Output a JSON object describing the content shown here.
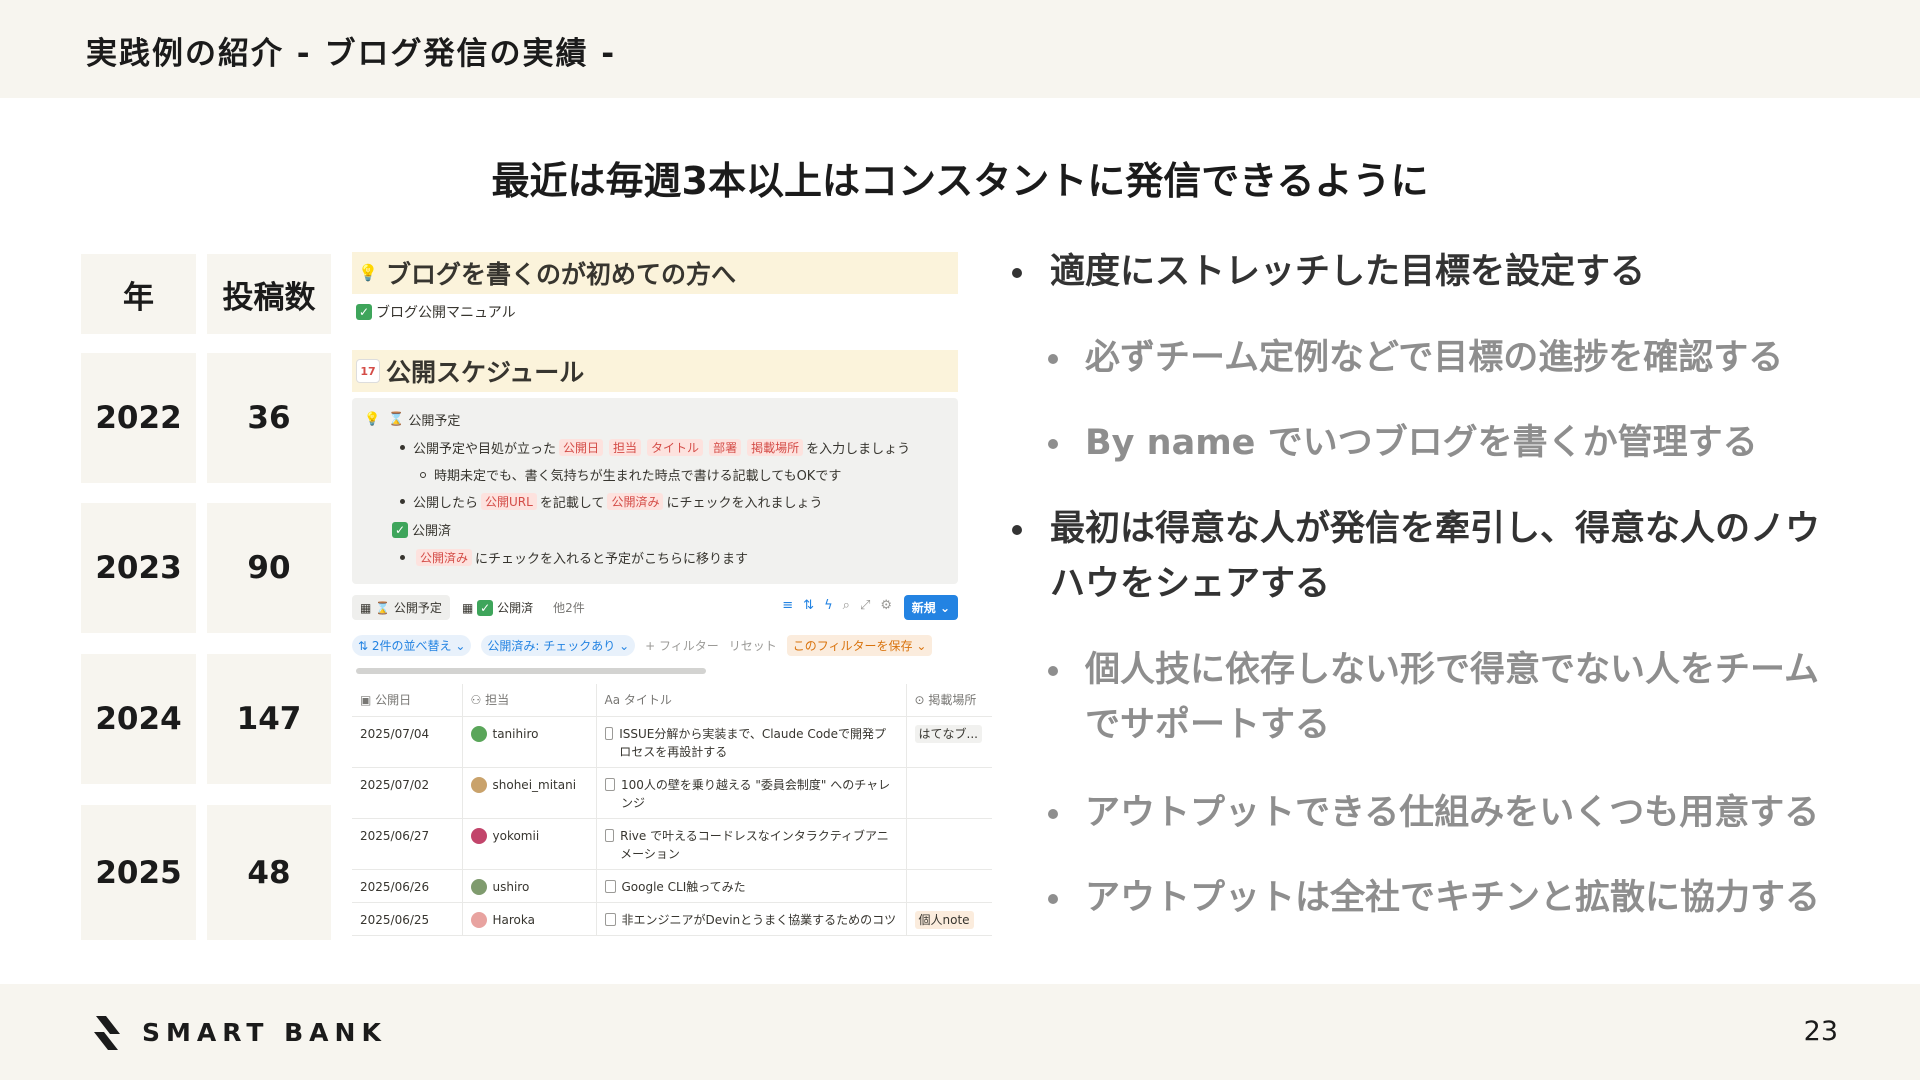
{
  "header": {
    "title": "実践例の紹介 - ブログ発信の実績 -"
  },
  "headline": "最近は毎週3本以上はコンスタントに発信できるように",
  "stats": {
    "col_year": "年",
    "col_posts": "投稿数",
    "rows": [
      {
        "year": "2022",
        "posts": "36"
      },
      {
        "year": "2023",
        "posts": "90"
      },
      {
        "year": "2024",
        "posts": "147"
      },
      {
        "year": "2025",
        "posts": "48"
      }
    ]
  },
  "notion": {
    "guide_heading": "ブログを書くのが初めての方へ",
    "manual_link": "ブログ公開マニュアル",
    "schedule_heading": "公開スケジュール",
    "callout": {
      "l1": "公開予定",
      "l2_pre": "公開予定や目処が立った",
      "tag_date": "公開日",
      "tag_owner": "担当",
      "tag_title": "タイトル",
      "tag_dept": "部署",
      "tag_place": "掲載場所",
      "l2_post": "を入力しましょう",
      "l3": "時期未定でも、書く気持ちが生まれた時点で書ける記載してもOKです",
      "l4_pre": "公開したら",
      "tag_url": "公開URL",
      "l4_mid": "を記載して",
      "tag_done": "公開済み",
      "l4_post": "にチェックを入れましょう",
      "l5": "公開済",
      "l6_tag": "公開済み",
      "l6_post": "にチェックを入れると予定がこちらに移ります"
    },
    "views": {
      "scheduled": "公開予定",
      "published": "公開済",
      "more": "他2件",
      "new_btn": "新規"
    },
    "filters": {
      "sort": "2件の並べ替え",
      "published_filter": "公開済み: チェックあり",
      "add_filter": "+ フィルター",
      "reset": "リセット",
      "save": "このフィルターを保存"
    },
    "columns": {
      "date": "公開日",
      "owner": "担当",
      "title": "タイトル",
      "place": "掲載場所"
    },
    "rows": [
      {
        "date": "2025/07/04",
        "owner": "tanihiro",
        "title": "ISSUE分解から実装まで、Claude Codeで開発プロセスを再設計する",
        "place": "はてなブ..."
      },
      {
        "date": "2025/07/02",
        "owner": "shohei_mitani",
        "title": "100人の壁を乗り越える \"委員会制度\" へのチャレンジ",
        "place": ""
      },
      {
        "date": "2025/06/27",
        "owner": "yokomii",
        "title": "Rive で叶えるコードレスなインタラクティブアニメーション",
        "place": ""
      },
      {
        "date": "2025/06/26",
        "owner": "ushiro",
        "title": "Google CLI触ってみた",
        "place": ""
      },
      {
        "date": "2025/06/25",
        "owner": "Haroka",
        "title": "非エンジニアがDevinとうまく協業するためのコツ",
        "place": "個人note"
      }
    ]
  },
  "bullets": {
    "b1": "適度にストレッチした目標を設定する",
    "b1a": "必ずチーム定例などで目標の進捗を確認する",
    "b1b": "By name でいつブログを書くか管理する",
    "b2": "最初は得意な人が発信を牽引し、得意な人のノウハウをシェアする",
    "b2a": "個人技に依存しない形で得意でない人をチームでサポートする",
    "b2b": "アウトプットできる仕組みをいくつも用意する",
    "b2c": "アウトプットは全社でキチンと拡散に協力する"
  },
  "footer": {
    "logo": "SMART BANK",
    "page": "23"
  },
  "colors": {
    "beige": "#f7f5ef",
    "notion_yellow": "#fbf3db",
    "notion_blue": "#2383e2",
    "tag_red": "#d44c47"
  }
}
